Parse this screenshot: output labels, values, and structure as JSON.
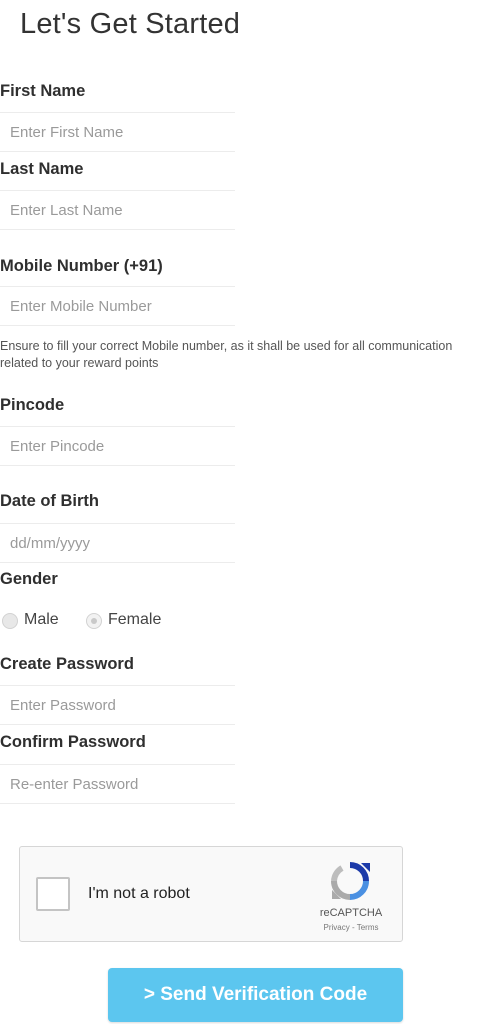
{
  "page": {
    "title": "Let's Get Started"
  },
  "form": {
    "first_name": {
      "label": "First Name",
      "placeholder": "Enter First Name"
    },
    "last_name": {
      "label": "Last Name",
      "placeholder": "Enter Last Name"
    },
    "mobile": {
      "label": "Mobile Number (+91)",
      "placeholder": "Enter Mobile Number",
      "help": "Ensure to fill your correct Mobile number, as it shall be used for all communication related to your reward points"
    },
    "pincode": {
      "label": "Pincode",
      "placeholder": "Enter Pincode"
    },
    "dob": {
      "label": "Date of Birth",
      "placeholder": "dd/mm/yyyy"
    },
    "gender": {
      "label": "Gender",
      "options": [
        "Male",
        "Female"
      ]
    },
    "password": {
      "label": "Create Password",
      "placeholder": "Enter Password"
    },
    "confirm_password": {
      "label": "Confirm Password",
      "placeholder": "Re-enter Password"
    }
  },
  "captcha": {
    "text": "I'm not a robot",
    "brand": "reCAPTCHA",
    "links": "Privacy - Terms"
  },
  "submit": {
    "label": "> Send Verification Code",
    "color": "#5cc6ef"
  }
}
